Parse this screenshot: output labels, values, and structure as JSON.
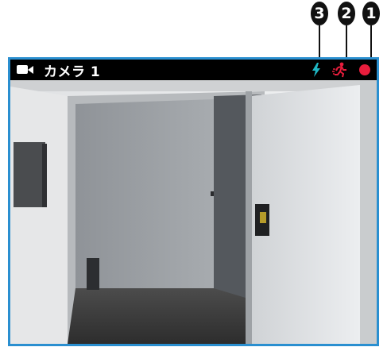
{
  "callouts": {
    "status_rec": "1",
    "status_motion": "2",
    "status_event": "3"
  },
  "camera": {
    "name": "カメラ 1",
    "icons": {
      "camera": "video-camera-icon",
      "event": "lightning-icon",
      "motion": "running-person-icon",
      "record": "recording-dot-icon"
    },
    "colors": {
      "border": "#2a8fd0",
      "event": "#1fb7c4",
      "motion": "#e81d3c",
      "record": "#e81d3c"
    }
  }
}
